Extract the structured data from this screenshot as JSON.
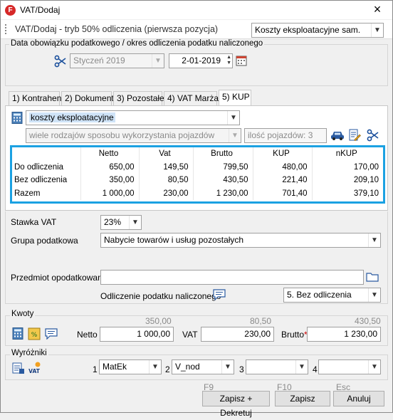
{
  "window": {
    "title": "VAT/Dodaj",
    "app_icon": "F"
  },
  "header": {
    "title": "VAT/Dodaj - tryb 50% odliczenia (pierwsza pozycja)",
    "category_select": "Koszty eksploatacyjne sam."
  },
  "dates": {
    "legend": "Data obowiązku podatkowego / okres odliczenia podatku naliczonego",
    "period": "Styczeń 2019",
    "date": "2-01-2019"
  },
  "tabs": [
    {
      "label": "1) Kontrahent"
    },
    {
      "label": "2) Dokument"
    },
    {
      "label": "3) Pozostałe"
    },
    {
      "label": "4) VAT Marża"
    },
    {
      "label": "5) KUP"
    }
  ],
  "kup": {
    "cost_type": "koszty eksploatacyjne",
    "usage_mode": "wiele rodzajów sposobu wykorzystania pojazdów",
    "vehicle_count": "ilość pojazdów: 3",
    "table": {
      "headers": [
        "",
        "Netto",
        "Vat",
        "Brutto",
        "KUP",
        "nKUP"
      ],
      "rows": [
        [
          "Do odliczenia",
          "650,00",
          "149,50",
          "799,50",
          "480,00",
          "170,00"
        ],
        [
          "Bez odliczenia",
          "350,00",
          "80,50",
          "430,50",
          "221,40",
          "209,10"
        ],
        [
          "Razem",
          "1 000,00",
          "230,00",
          "1 230,00",
          "701,40",
          "379,10"
        ]
      ]
    }
  },
  "form": {
    "vat_rate_label": "Stawka VAT",
    "vat_rate": "23%",
    "tax_group_label": "Grupa podatkowa",
    "tax_group": "Nabycie towarów i usług pozostałych",
    "subject_label": "Przedmiot opodatkowania",
    "subject_value": "",
    "deduction_label": "Odliczenie podatku naliczonego",
    "deduction_value": "5. Bez odliczenia"
  },
  "amounts": {
    "legend": "Kwoty",
    "netto_hint": "350,00",
    "vat_hint": "80,50",
    "brutto_hint": "430,50",
    "netto_label": "Netto",
    "netto": "1 000,00",
    "vat_label": "VAT",
    "vat": "230,00",
    "brutto_label": "Brutto",
    "brutto_required": "*",
    "brutto": "1 230,00"
  },
  "distinctions": {
    "legend": "Wyróżniki",
    "fields": [
      {
        "num": "1",
        "value": "MatEk"
      },
      {
        "num": "2",
        "value": "V_nod"
      },
      {
        "num": "3",
        "value": ""
      },
      {
        "num": "4",
        "value": ""
      }
    ]
  },
  "footer": {
    "save_post_hint": "F9",
    "save_post": "Zapisz + Dekretuj",
    "save_hint": "F10",
    "save": "Zapisz",
    "cancel_hint": "Esc",
    "cancel": "Anuluj"
  },
  "colors": {
    "accent": "#1ba1e2",
    "app_icon": "#d62828",
    "required": "#d00000"
  }
}
